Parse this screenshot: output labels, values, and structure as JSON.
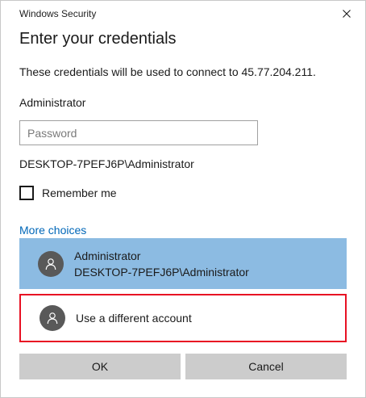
{
  "window": {
    "title": "Windows Security",
    "close_icon": "close-icon"
  },
  "dialog": {
    "heading": "Enter your credentials",
    "description": "These credentials will be used to connect to 45.77.204.211.",
    "username": "Administrator",
    "password": {
      "placeholder": "Password",
      "value": ""
    },
    "domain_user": "DESKTOP-7PEFJ6P\\Administrator",
    "remember_me": {
      "label": "Remember me",
      "checked": false
    },
    "more_choices": "More choices",
    "accounts": [
      {
        "name": "Administrator",
        "detail": "DESKTOP-7PEFJ6P\\Administrator",
        "icon": "user-icon",
        "selected": true
      },
      {
        "name": "Use a different account",
        "icon": "user-icon",
        "selected": false
      }
    ]
  },
  "buttons": {
    "ok": "OK",
    "cancel": "Cancel"
  },
  "colors": {
    "selected_account_bg": "#8cbbe2",
    "link": "#0067b8",
    "highlight_border": "#e81123",
    "button_bg": "#cccccc",
    "avatar_bg": "#595959"
  }
}
